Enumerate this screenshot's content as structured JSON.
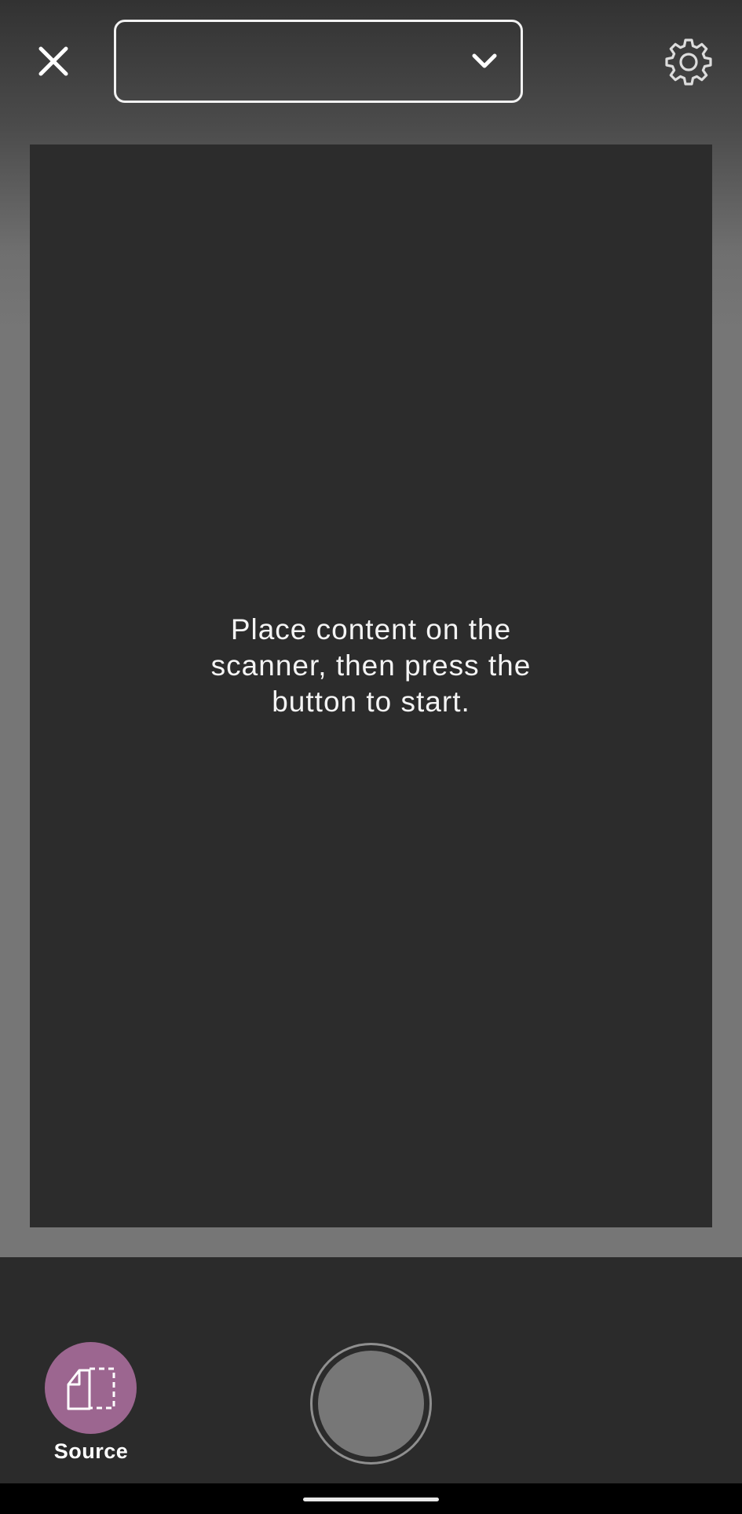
{
  "header": {
    "close_icon": "close-icon",
    "profile_dropdown": {
      "value": "",
      "icon": "chevron-down-icon"
    },
    "settings_icon": "gear-icon"
  },
  "preview": {
    "message": "Place content on the scanner, then press the button to start."
  },
  "toolbar": {
    "source_label": "Source",
    "source_icon": "source-page-icon",
    "shutter_icon": "shutter-button"
  },
  "colors": {
    "source_button": "#9c6690",
    "preview_background": "#2c2c2c",
    "frame_background": "#767676",
    "bottom_bar": "#2b2b2b"
  }
}
